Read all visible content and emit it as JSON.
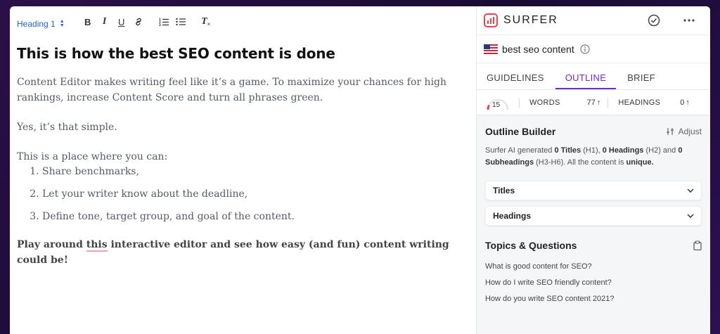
{
  "toolbar": {
    "heading_select": "Heading 1",
    "icons": [
      "bold-icon",
      "italic-icon",
      "underline-icon",
      "link-icon",
      "ordered-list-icon",
      "bullet-list-icon",
      "clear-format-icon"
    ]
  },
  "document": {
    "title": "This is how the best SEO content is done",
    "p1": "Content Editor makes writing feel like it’s a game. To maximize your chances for high rankings, increase Content Score and turn all phrases green.",
    "p2": "Yes, it’s that simple.",
    "p3": "This is a place where you can:",
    "list": [
      "Share benchmarks,",
      "Let your writer know about the deadline,",
      "Define tone, target group, and goal of the content."
    ],
    "final_prefix": "Play around ",
    "final_underlined": "this",
    "final_suffix": " interactive editor and see how easy (and fun) content writing could be!"
  },
  "sidebar": {
    "brand": "SURFER",
    "brand_color": "#e8434f",
    "keyword": "best seo content",
    "tabs": [
      "GUIDELINES",
      "OUTLINE",
      "BRIEF"
    ],
    "active_tab": "OUTLINE",
    "accent": "#6b2bd4",
    "score": "15",
    "words_label": "WORDS",
    "words_value": "77",
    "headings_label": "HEADINGS",
    "headings_value": "0",
    "outline_title": "Outline Builder",
    "adjust_label": "Adjust",
    "gen": {
      "t1": "Surfer AI generated ",
      "titles": "0 Titles",
      "t2": " (H1), ",
      "headings": "0 Headings",
      "t3": " (H2) and ",
      "subheadings": "0 Subheadings",
      "t4": " (H3-H6). All the content is ",
      "unique": "unique.",
      "t5": ""
    },
    "accordions": [
      "Titles",
      "Headings"
    ],
    "topics_title": "Topics & Questions",
    "questions": [
      "What is good content for SEO?",
      "How do I write SEO friendly content?",
      "How do you write SEO content 2021?"
    ]
  }
}
